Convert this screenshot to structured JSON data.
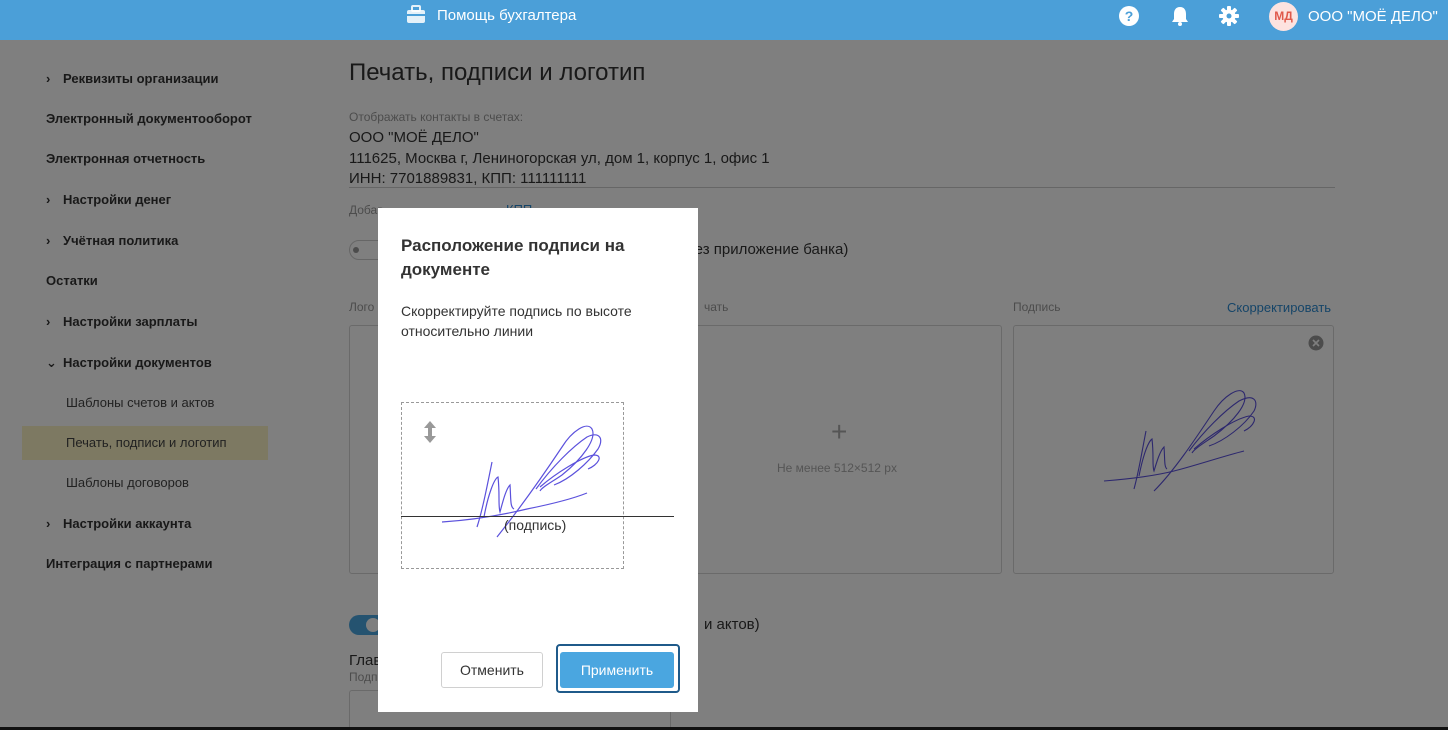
{
  "header": {
    "help_label": "Помощь бухгалтера",
    "user_initials": "МД",
    "user_name": "ООО \"МОЁ ДЕЛО\""
  },
  "sidebar": {
    "items": [
      {
        "label": "Реквизиты организации",
        "chevron": "›"
      },
      {
        "label": "Электронный документооборот"
      },
      {
        "label": "Электронная отчетность"
      },
      {
        "label": "Настройки денег",
        "chevron": "›"
      },
      {
        "label": "Учётная политика",
        "chevron": "›"
      },
      {
        "label": "Остатки"
      },
      {
        "label": "Настройки зарплаты",
        "chevron": "›"
      },
      {
        "label": "Настройки документов",
        "chevron": "⌄"
      },
      {
        "label": "Настройки аккаунта",
        "chevron": "›"
      },
      {
        "label": "Интеграция с партнерами"
      }
    ],
    "subitems": [
      {
        "label": "Шаблоны счетов и актов"
      },
      {
        "label": "Печать, подписи и логотип"
      },
      {
        "label": "Шаблоны договоров"
      }
    ]
  },
  "main": {
    "title": "Печать, подписи и логотип",
    "contacts_label": "Отображать контакты в счетах:",
    "contacts": [
      "ООО \"МОЁ ДЕЛО\"",
      "111625, Москва г, Лениногорская ул, дом 1, корпус 1, офис 1",
      "ИНН: 7701889831, КПП: 111111111"
    ],
    "add_prefix": "Добав",
    "add_link": "КПП",
    "toggle1_text": "ерез приложение банка)",
    "logo_label": "Лого",
    "stamp_label": "чать",
    "signature_label": "Подпись",
    "correct_link": "Скорректировать",
    "size_hint": "Не менее 512×512 px",
    "toggle2_text": "и актов)",
    "chief_label": "Глав",
    "chief_sublabel": "Подп"
  },
  "modal": {
    "title": "Расположение подписи на документе",
    "description": "Скорректируйте подпись по высоте относительно линии",
    "caption": "(подпись)",
    "cancel_label": "Отменить",
    "apply_label": "Применить"
  },
  "colors": {
    "header": "#4b9fd8",
    "accent": "#4aa6e0",
    "signature_ink": "#4a3fd9"
  }
}
